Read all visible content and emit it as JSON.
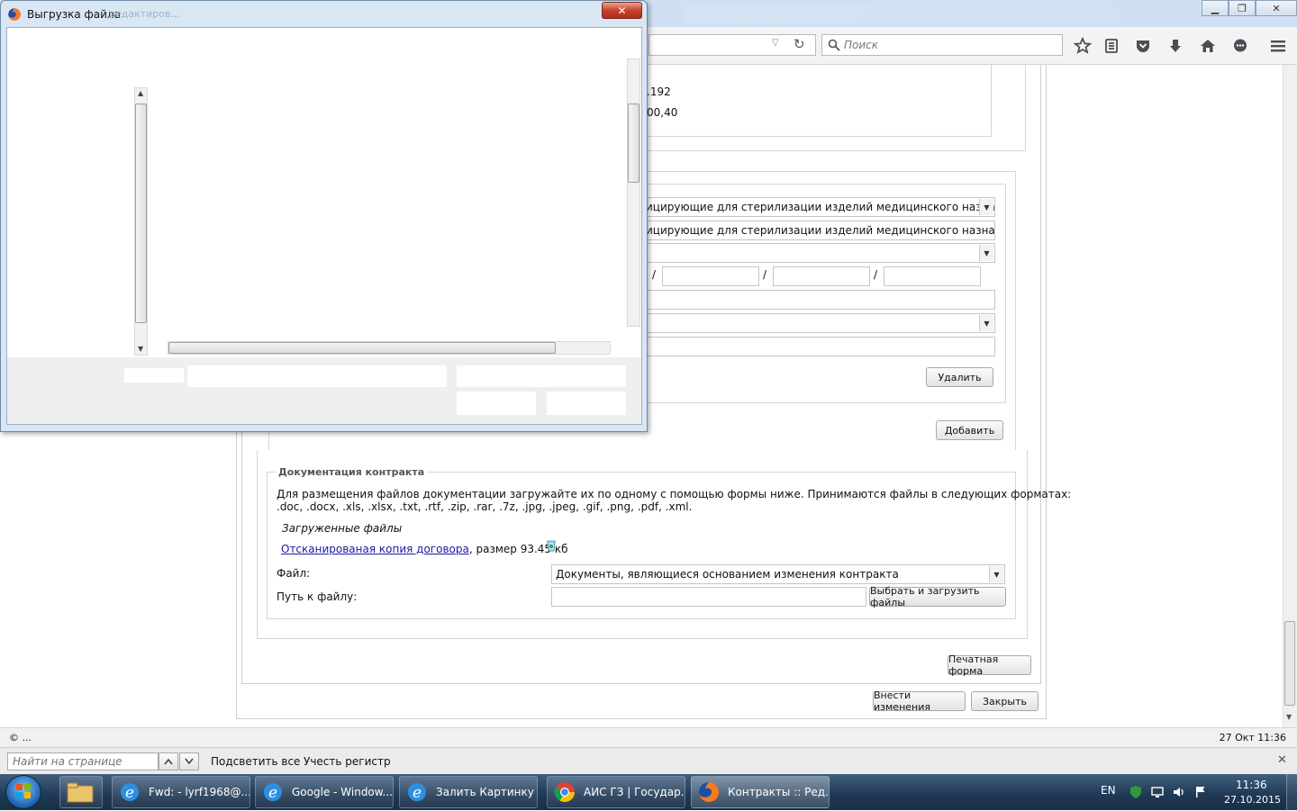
{
  "browser": {
    "search_placeholder": "Поиск",
    "status_left": "© ...",
    "status_right": "27 Окт 11:36",
    "window_controls": {
      "minimize": "▁",
      "restore": "❐",
      "close": "✕"
    }
  },
  "popup": {
    "title": "Выгрузка файла",
    "title_ghost": "редактиров...",
    "close_label": "✕"
  },
  "page": {
    "partial_value_1": ".192",
    "partial_value_2": "00,40",
    "select_1_value": "ицирующие для стерилизации изделий медицинского назначен",
    "input_2_value": "ицирующие для стерилизации изделий медицинского назначения",
    "slash": "/",
    "delete_button": "Удалить",
    "add_button": "Добавить",
    "docs": {
      "legend": "Документация контракта",
      "description_line1": "Для размещения файлов документации загружайте их по одному с помощью формы ниже. Принимаются файлы в следующих форматах:",
      "description_line2": ".doc, .docx, .xls, .xlsx, .txt, .rtf, .zip, .rar, .7z, .jpg, .jpeg, .gif, .png, .pdf, .xml.",
      "uploaded_heading": "Загруженные файлы",
      "file_link": "Отсканированая копия договора",
      "file_size": ", размер 93.45 кб",
      "file_label": "Файл:",
      "file_select_value": "Документы, являющиеся основанием изменения контракта",
      "path_label": "Путь к файлу:",
      "upload_button": "Выбрать и загрузить файлы"
    },
    "print_button": "Печатная форма",
    "save_button": "Внести изменения",
    "close_button": "Закрыть"
  },
  "findbar": {
    "placeholder": "Найти на странице",
    "highlight_all": "Подсветить все",
    "match_case": "Учесть регистр",
    "close": "✕"
  },
  "taskbar": {
    "items": [
      {
        "label": "Fwd: - lyrf1968@...",
        "icon": "ie-icon"
      },
      {
        "label": "Google - Window...",
        "icon": "ie-icon"
      },
      {
        "label": "Залить Картинку ...",
        "icon": "ie-icon"
      },
      {
        "label": "АИС ГЗ | Государ...",
        "icon": "chrome-icon"
      },
      {
        "label": "Контракты :: Ред...",
        "icon": "firefox-icon"
      }
    ],
    "lang": "EN",
    "time": "11:36",
    "date": "27.10.2015"
  },
  "colors": {
    "link": "#1a1aa6",
    "taskbar": "#1f3854",
    "popup_frame": "#d9e6f3"
  }
}
